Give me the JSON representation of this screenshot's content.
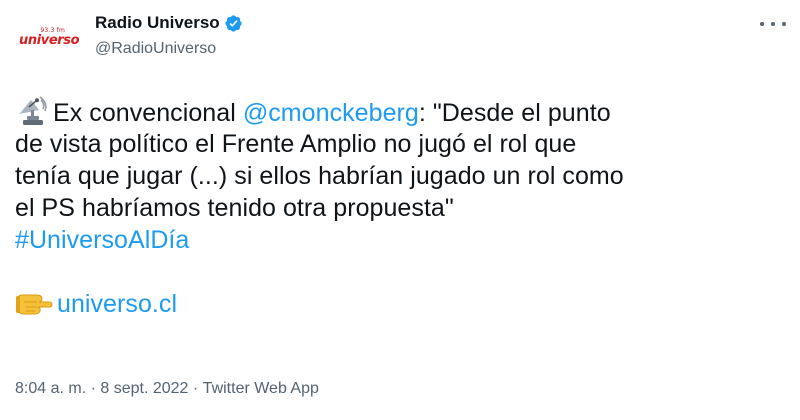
{
  "user": {
    "display_name": "Radio Universo",
    "handle": "@RadioUniverso",
    "avatar_logo_small": "93.3 fm",
    "avatar_logo_text": "universo"
  },
  "tweet": {
    "line1_prefix": "Ex convencional ",
    "mention": "@cmonckeberg",
    "line1_suffix": ": \"Desde el punto",
    "line2": "de vista político el Frente Amplio no jugó el rol que",
    "line3": "tenía que jugar (...) si ellos habrían jugado un rol como",
    "line4": "el PS habríamos tenido otra propuesta\"",
    "hashtag": "#UniversoAlDía",
    "link": "universo.cl"
  },
  "icons": {
    "lead": "satellite-antenna-emoji",
    "link": "pointing-hand-emoji",
    "verified": "verified-badge",
    "more": "more-options"
  },
  "meta": {
    "time": "8:04 a. m.",
    "separator": " · ",
    "date": "8 sept. 2022",
    "source": "Twitter Web App"
  },
  "colors": {
    "link": "#1d9bf0",
    "text": "#0f1419",
    "secondary": "#536471",
    "brand": "#d81e1e"
  }
}
